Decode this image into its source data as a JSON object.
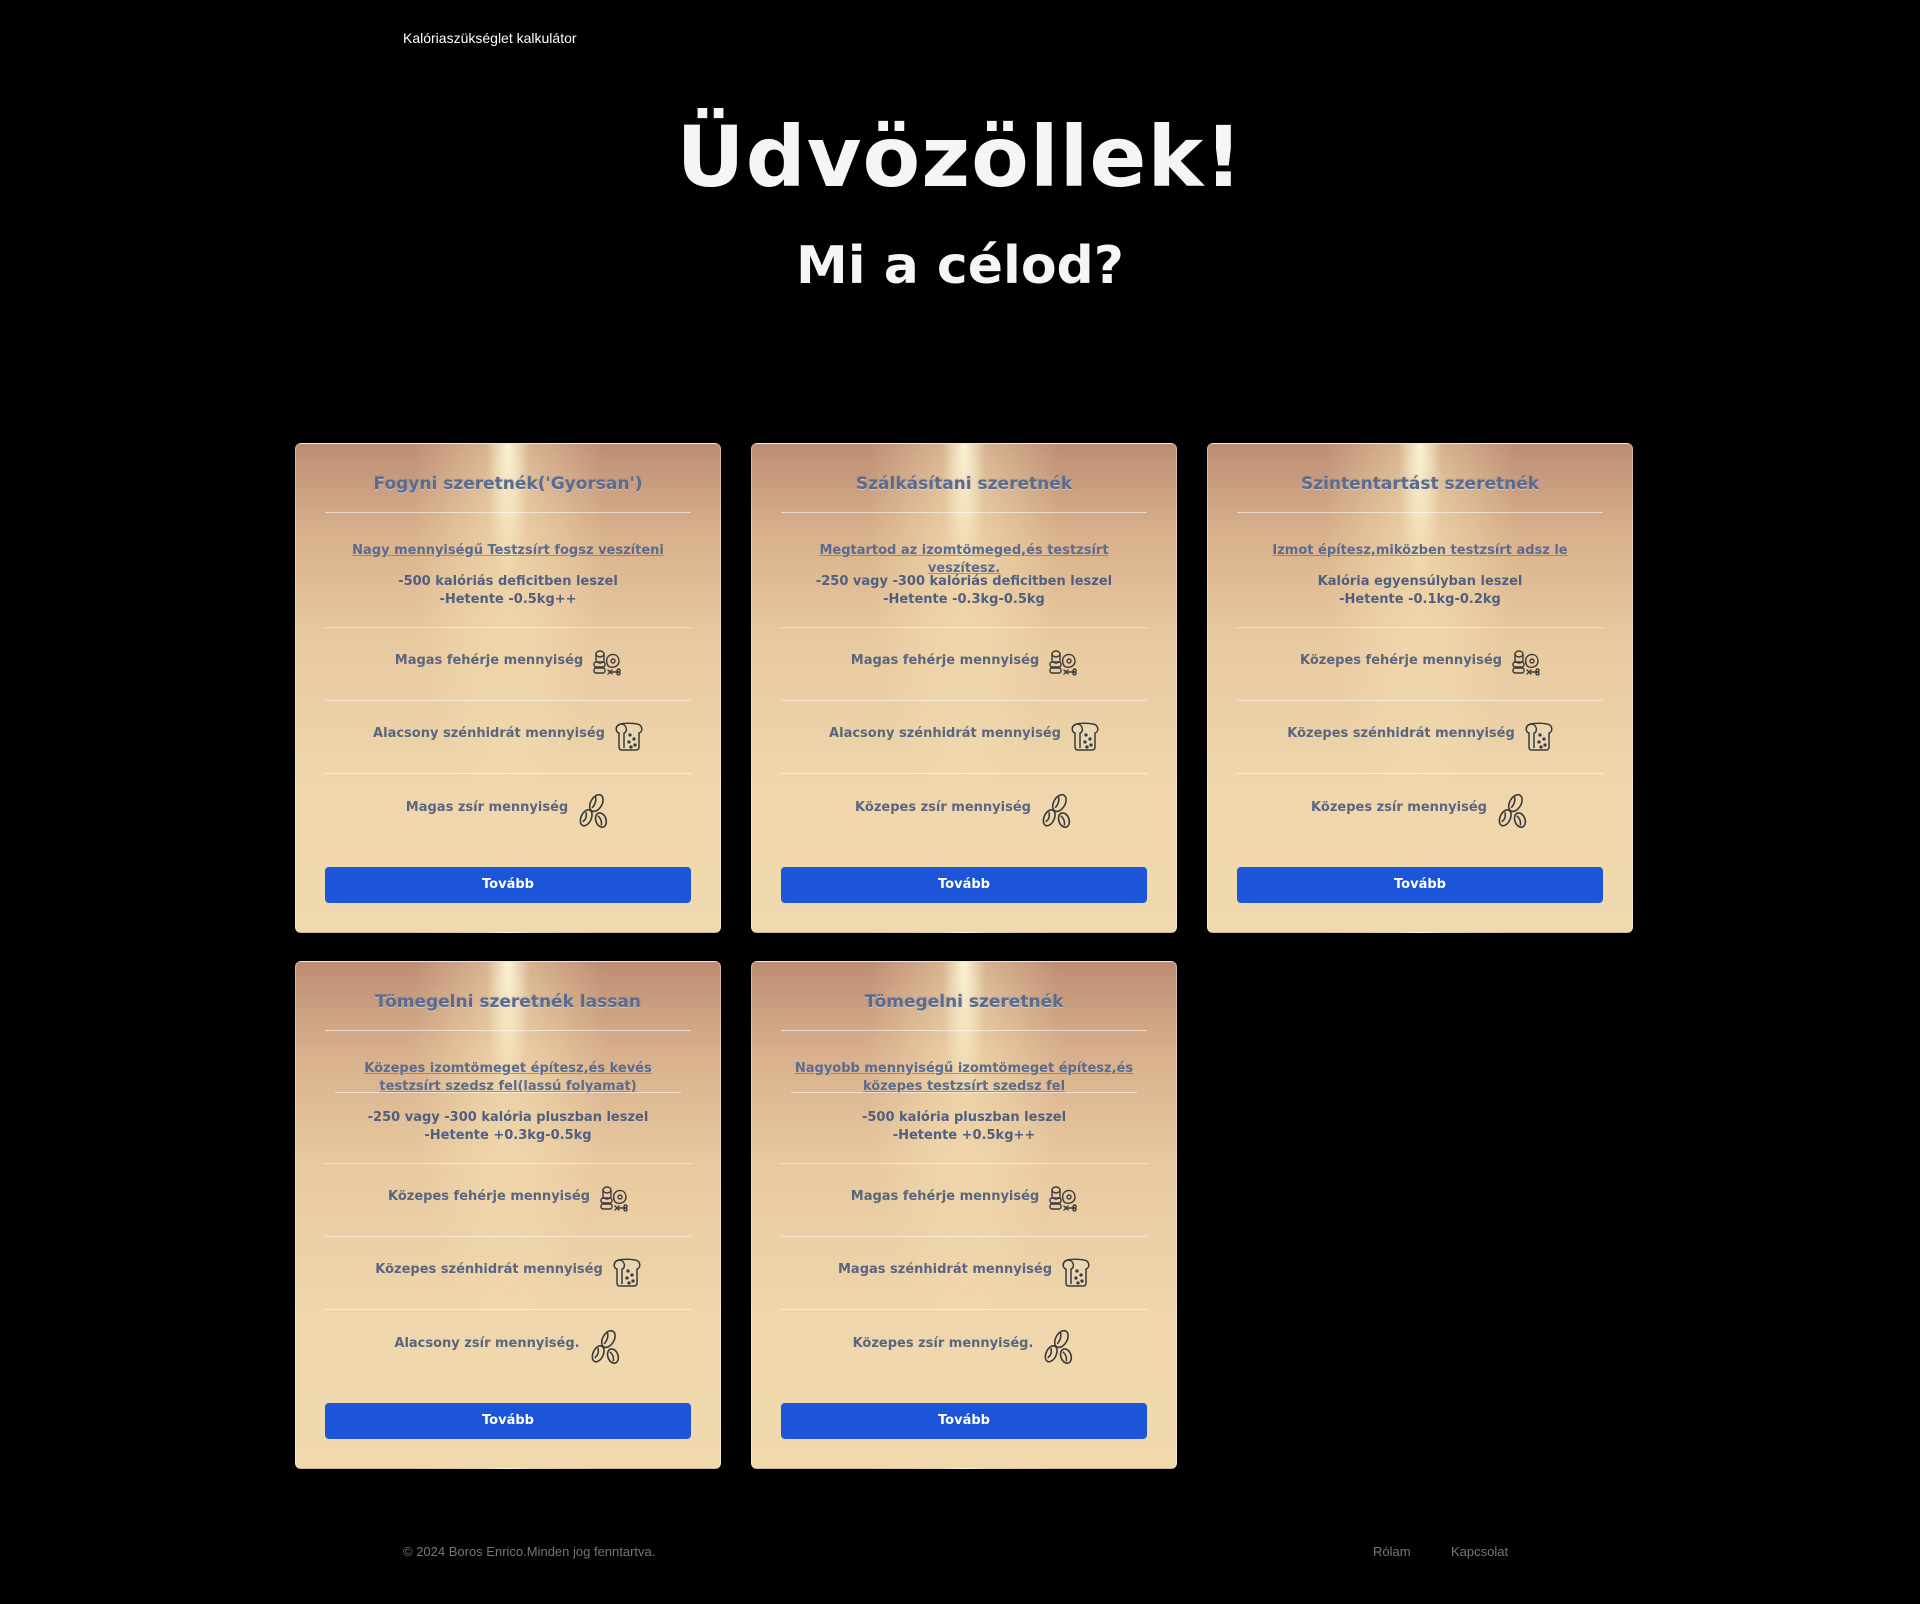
{
  "nav": {
    "brand": "Kalóriaszükséglet kalkulátor"
  },
  "hero": {
    "title": "Üdvözöllek!",
    "subtitle": "Mi a célod?"
  },
  "cards": [
    {
      "title": "Fogyni szeretnék('Gyorsan')",
      "description": "Nagy mennyiségű Testzsírt fogsz veszíteni",
      "info_line1": "-500 kalóriás deficitben leszel",
      "info_line2": "-Hetente -0.5kg++",
      "protein": "Magas fehérje mennyiség",
      "carbs": "Alacsony szénhidrát mennyiség",
      "fat": "Magas zsír mennyiség",
      "button": "Tovább"
    },
    {
      "title": "Szálkásítani szeretnék",
      "description": "Megtartod az izomtömeged,és testzsírt veszítesz.",
      "info_line1": "-250 vagy -300 kalóriás deficitben leszel",
      "info_line2": "-Hetente -0.3kg-0.5kg",
      "protein": "Magas fehérje mennyiség",
      "carbs": "Alacsony szénhidrát mennyiség",
      "fat": "Közepes zsír mennyiség",
      "button": "Tovább"
    },
    {
      "title": "Szintentartást szeretnék",
      "description": "Izmot építesz,miközben testzsírt adsz le",
      "info_line1": "Kalória egyensúlyban leszel",
      "info_line2": "-Hetente -0.1kg-0.2kg",
      "protein": "Közepes fehérje mennyiség",
      "carbs": "Közepes szénhidrát mennyiség",
      "fat": "Közepes zsír mennyiség",
      "button": "Tovább"
    },
    {
      "title": "Tömegelni szeretnék lassan",
      "description": "Közepes izomtömeget építesz,és kevés testzsírt szedsz fel(lassú folyamat)",
      "info_line1": "-250 vagy -300 kalória pluszban leszel",
      "info_line2": "-Hetente +0.3kg-0.5kg",
      "protein": "Közepes fehérje mennyiség",
      "carbs": "Közepes szénhidrát mennyiség",
      "fat": "Alacsony zsír mennyiség.",
      "button": "Tovább"
    },
    {
      "title": "Tömegelni szeretnék",
      "description": "Nagyobb mennyiségű izomtömeget építesz,és közepes testzsírt szedsz fel",
      "info_line1": "-500 kalória pluszban leszel",
      "info_line2": "-Hetente +0.5kg++",
      "protein": "Magas fehérje mennyiség",
      "carbs": "Magas szénhidrát mennyiség",
      "fat": "Közepes zsír mennyiség.",
      "button": "Tovább"
    }
  ],
  "icons": {
    "protein": "protein-food-icon",
    "carbs": "bread-icon",
    "fat": "seeds-icon"
  },
  "footer": {
    "copyright": "© 2024 Boros Enrico.Minden jog fenntartva.",
    "about": "Rólam",
    "contact": "Kapcsolat"
  },
  "colors": {
    "background": "#000000",
    "button": "#1c55d9",
    "card_text": "#5a6b8e"
  }
}
